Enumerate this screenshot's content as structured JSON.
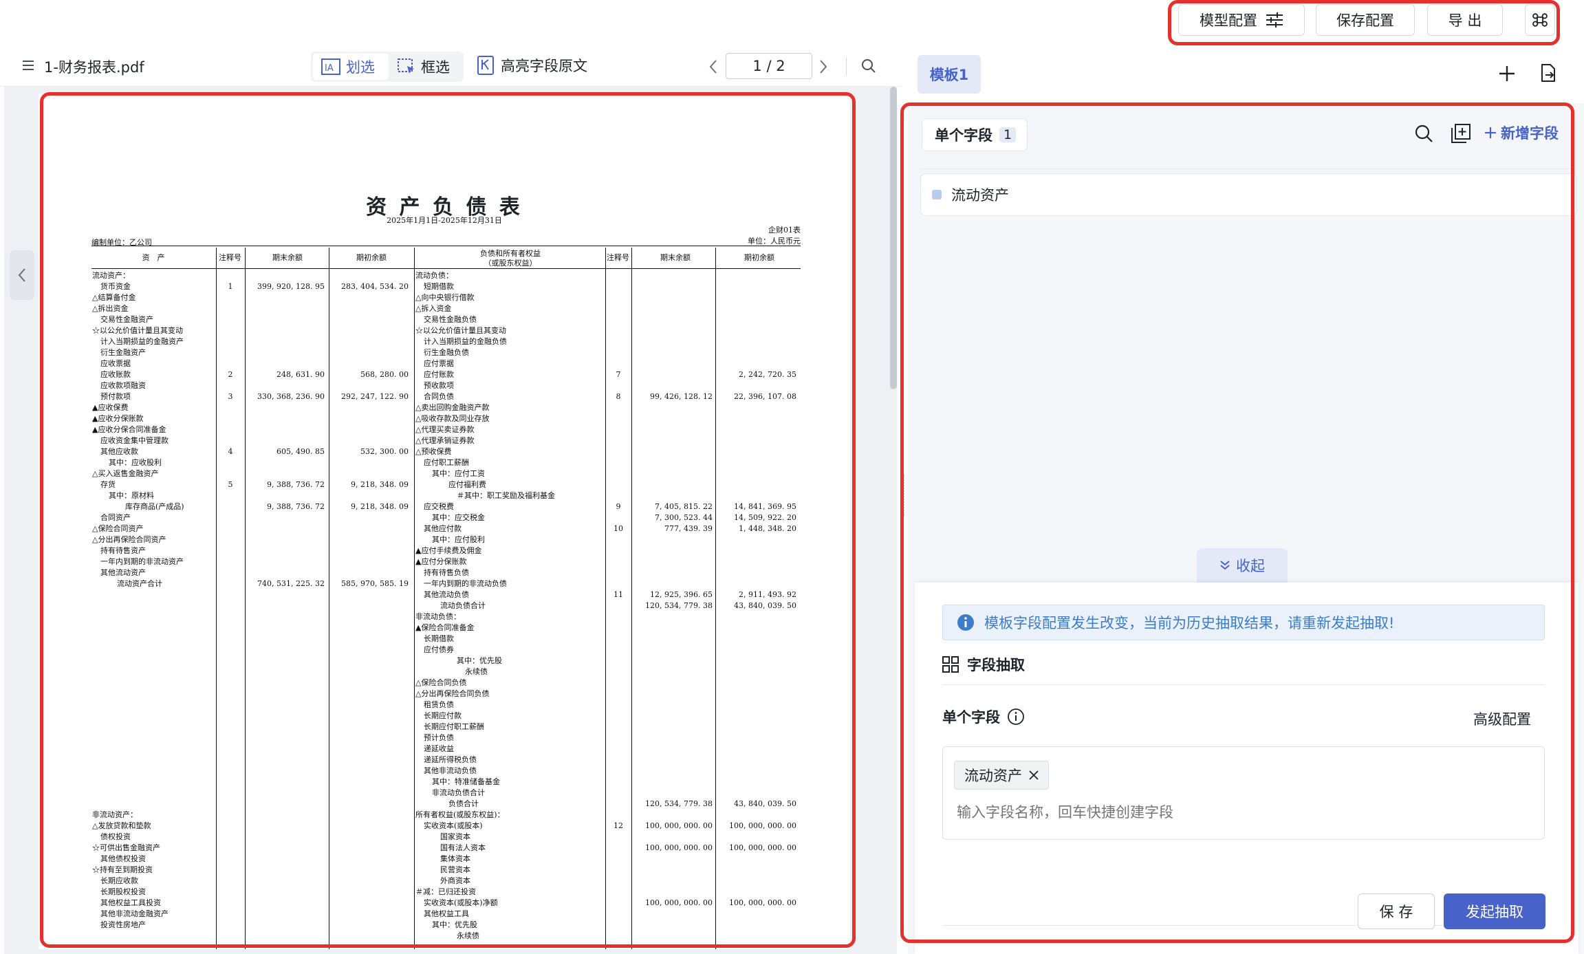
{
  "toolbar": {
    "model_config_label": "模型配置",
    "save_config_label": "保存配置",
    "export_label": "导 出",
    "command_icon": "command-icon"
  },
  "viewer_header": {
    "file_name": "1-财务报表.pdf",
    "mode_line_select": "划选",
    "mode_box_select": "框选",
    "highlight_original": "高亮字段原文",
    "page_indicator": "1 / 2"
  },
  "document": {
    "title": "资 产 负 债 表",
    "period": "2025年1月1日-2025年12月31日",
    "form_no": "企财01表",
    "unit": "单位：人民币元",
    "company": "编制单位：乙公司",
    "headers": {
      "left_item": "资　产",
      "note": "注释号",
      "end_balance": "期末余额",
      "begin_balance": "期初余额",
      "right_item_line1": "负债和所有者权益",
      "right_item_line2": "（或股东权益）"
    },
    "left_rows": [
      {
        "y": 0,
        "label": "流动资产：",
        "indent": 0,
        "note": "",
        "end": "",
        "begin": ""
      },
      {
        "y": 1,
        "label": "货币资金",
        "indent": 1,
        "note": "1",
        "end": "399, 920, 128. 95",
        "begin": "283, 404, 534. 20"
      },
      {
        "y": 2,
        "label": "△结算备付金",
        "indent": 0,
        "note": "",
        "end": "",
        "begin": ""
      },
      {
        "y": 3,
        "label": "△拆出资金",
        "indent": 0,
        "note": "",
        "end": "",
        "begin": ""
      },
      {
        "y": 4,
        "label": "交易性金融资产",
        "indent": 1,
        "note": "",
        "end": "",
        "begin": ""
      },
      {
        "y": 5,
        "label": "☆以公允价值计量且其变动",
        "indent": 0,
        "note": "",
        "end": "",
        "begin": ""
      },
      {
        "y": 6,
        "label": "计入当期损益的金融资产",
        "indent": 1,
        "note": "",
        "end": "",
        "begin": ""
      },
      {
        "y": 7,
        "label": "衍生金融资产",
        "indent": 1,
        "note": "",
        "end": "",
        "begin": ""
      },
      {
        "y": 8,
        "label": "应收票据",
        "indent": 1,
        "note": "",
        "end": "",
        "begin": ""
      },
      {
        "y": 9,
        "label": "应收账款",
        "indent": 1,
        "note": "2",
        "end": "248, 631. 90",
        "begin": "568, 280. 00"
      },
      {
        "y": 10,
        "label": "应收款项融资",
        "indent": 1,
        "note": "",
        "end": "",
        "begin": ""
      },
      {
        "y": 11,
        "label": "预付款项",
        "indent": 1,
        "note": "3",
        "end": "330, 368, 236. 90",
        "begin": "292, 247, 122. 90"
      },
      {
        "y": 12,
        "label": "▲应收保费",
        "indent": 0,
        "note": "",
        "end": "",
        "begin": ""
      },
      {
        "y": 13,
        "label": "▲应收分保账款",
        "indent": 0,
        "note": "",
        "end": "",
        "begin": ""
      },
      {
        "y": 14,
        "label": "▲应收分保合同准备金",
        "indent": 0,
        "note": "",
        "end": "",
        "begin": ""
      },
      {
        "y": 15,
        "label": "应收资金集中管理款",
        "indent": 1,
        "note": "",
        "end": "",
        "begin": ""
      },
      {
        "y": 16,
        "label": "其他应收款",
        "indent": 1,
        "note": "4",
        "end": "605, 490. 85",
        "begin": "532, 300. 00"
      },
      {
        "y": 17,
        "label": "其中：应收股利",
        "indent": 2,
        "note": "",
        "end": "",
        "begin": ""
      },
      {
        "y": 18,
        "label": "△买入返售金融资产",
        "indent": 0,
        "note": "",
        "end": "",
        "begin": ""
      },
      {
        "y": 19,
        "label": "存货",
        "indent": 1,
        "note": "5",
        "end": "9, 388, 736. 72",
        "begin": "9, 218, 348. 09"
      },
      {
        "y": 20,
        "label": "其中：原材料",
        "indent": 2,
        "note": "",
        "end": "",
        "begin": ""
      },
      {
        "y": 21,
        "label": "库存商品(产成品)",
        "indent": 4,
        "note": "",
        "end": "9, 388, 736. 72",
        "begin": "9, 218, 348. 09"
      },
      {
        "y": 22,
        "label": "合同资产",
        "indent": 1,
        "note": "",
        "end": "",
        "begin": ""
      },
      {
        "y": 23,
        "label": "△保险合同资产",
        "indent": 0,
        "note": "",
        "end": "",
        "begin": ""
      },
      {
        "y": 24,
        "label": "△分出再保险合同资产",
        "indent": 0,
        "note": "",
        "end": "",
        "begin": ""
      },
      {
        "y": 25,
        "label": "持有待售资产",
        "indent": 1,
        "note": "",
        "end": "",
        "begin": ""
      },
      {
        "y": 26,
        "label": "一年内到期的非流动资产",
        "indent": 1,
        "note": "",
        "end": "",
        "begin": ""
      },
      {
        "y": 27,
        "label": "其他流动资产",
        "indent": 1,
        "note": "",
        "end": "",
        "begin": ""
      },
      {
        "y": 28,
        "label": "流动资产合计",
        "indent": 3,
        "note": "",
        "end": "740, 531, 225. 32",
        "begin": "585, 970, 585. 19"
      },
      {
        "y": 49,
        "label": "非流动资产：",
        "indent": 0,
        "note": "",
        "end": "",
        "begin": ""
      },
      {
        "y": 50,
        "label": "△发放贷款和垫款",
        "indent": 0,
        "note": "",
        "end": "",
        "begin": ""
      },
      {
        "y": 51,
        "label": "债权投资",
        "indent": 1,
        "note": "",
        "end": "",
        "begin": ""
      },
      {
        "y": 52,
        "label": "☆可供出售金融资产",
        "indent": 0,
        "note": "",
        "end": "",
        "begin": ""
      },
      {
        "y": 53,
        "label": "其他债权投资",
        "indent": 1,
        "note": "",
        "end": "",
        "begin": ""
      },
      {
        "y": 54,
        "label": "☆持有至到期投资",
        "indent": 0,
        "note": "",
        "end": "",
        "begin": ""
      },
      {
        "y": 55,
        "label": "长期应收款",
        "indent": 1,
        "note": "",
        "end": "",
        "begin": ""
      },
      {
        "y": 56,
        "label": "长期股权投资",
        "indent": 1,
        "note": "",
        "end": "",
        "begin": ""
      },
      {
        "y": 57,
        "label": "其他权益工具投资",
        "indent": 1,
        "note": "",
        "end": "",
        "begin": ""
      },
      {
        "y": 58,
        "label": "其他非流动金融资产",
        "indent": 1,
        "note": "",
        "end": "",
        "begin": ""
      },
      {
        "y": 59,
        "label": "投资性房地产",
        "indent": 1,
        "note": "",
        "end": "",
        "begin": ""
      }
    ],
    "right_rows": [
      {
        "y": 0,
        "label": "流动负债：",
        "indent": 0,
        "note": "",
        "end": "",
        "begin": ""
      },
      {
        "y": 1,
        "label": "短期借款",
        "indent": 1,
        "note": "",
        "end": "",
        "begin": ""
      },
      {
        "y": 2,
        "label": "△向中央银行借款",
        "indent": 0,
        "note": "",
        "end": "",
        "begin": ""
      },
      {
        "y": 3,
        "label": "△拆入资金",
        "indent": 0,
        "note": "",
        "end": "",
        "begin": ""
      },
      {
        "y": 4,
        "label": "交易性金融负债",
        "indent": 1,
        "note": "",
        "end": "",
        "begin": ""
      },
      {
        "y": 5,
        "label": "☆以公允价值计量且其变动",
        "indent": 0,
        "note": "",
        "end": "",
        "begin": ""
      },
      {
        "y": 6,
        "label": "计入当期损益的金融负债",
        "indent": 1,
        "note": "",
        "end": "",
        "begin": ""
      },
      {
        "y": 7,
        "label": "衍生金融负债",
        "indent": 1,
        "note": "",
        "end": "",
        "begin": ""
      },
      {
        "y": 8,
        "label": "应付票据",
        "indent": 1,
        "note": "",
        "end": "",
        "begin": ""
      },
      {
        "y": 9,
        "label": "应付账款",
        "indent": 1,
        "note": "7",
        "end": "",
        "begin": "2, 242, 720. 35"
      },
      {
        "y": 10,
        "label": "预收款项",
        "indent": 1,
        "note": "",
        "end": "",
        "begin": ""
      },
      {
        "y": 11,
        "label": "合同负债",
        "indent": 1,
        "note": "8",
        "end": "99, 426, 128. 12",
        "begin": "22, 396, 107. 08"
      },
      {
        "y": 12,
        "label": "△卖出回购金融资产款",
        "indent": 0,
        "note": "",
        "end": "",
        "begin": ""
      },
      {
        "y": 13,
        "label": "△吸收存款及同业存放",
        "indent": 0,
        "note": "",
        "end": "",
        "begin": ""
      },
      {
        "y": 14,
        "label": "△代理买卖证券款",
        "indent": 0,
        "note": "",
        "end": "",
        "begin": ""
      },
      {
        "y": 15,
        "label": "△代理承销证券款",
        "indent": 0,
        "note": "",
        "end": "",
        "begin": ""
      },
      {
        "y": 16,
        "label": "△预收保费",
        "indent": 0,
        "note": "",
        "end": "",
        "begin": ""
      },
      {
        "y": 17,
        "label": "应付职工薪酬",
        "indent": 1,
        "note": "",
        "end": "",
        "begin": ""
      },
      {
        "y": 18,
        "label": "其中：应付工资",
        "indent": 2,
        "note": "",
        "end": "",
        "begin": ""
      },
      {
        "y": 19,
        "label": "应付福利费",
        "indent": 4,
        "note": "",
        "end": "",
        "begin": ""
      },
      {
        "y": 20,
        "label": "＃其中：职工奖励及福利基金",
        "indent": 5,
        "note": "",
        "end": "",
        "begin": ""
      },
      {
        "y": 21,
        "label": "应交税费",
        "indent": 1,
        "note": "9",
        "end": "7, 405, 815. 22",
        "begin": "14, 841, 369. 95"
      },
      {
        "y": 22,
        "label": "其中：应交税金",
        "indent": 2,
        "note": "",
        "end": "7, 300, 523. 44",
        "begin": "14, 509, 922. 20"
      },
      {
        "y": 23,
        "label": "其他应付款",
        "indent": 1,
        "note": "10",
        "end": "777, 439. 39",
        "begin": "1, 448, 348. 20"
      },
      {
        "y": 24,
        "label": "其中：应付股利",
        "indent": 2,
        "note": "",
        "end": "",
        "begin": ""
      },
      {
        "y": 25,
        "label": "▲应付手续费及佣金",
        "indent": 0,
        "note": "",
        "end": "",
        "begin": ""
      },
      {
        "y": 26,
        "label": "▲应付分保账款",
        "indent": 0,
        "note": "",
        "end": "",
        "begin": ""
      },
      {
        "y": 27,
        "label": "持有待售负债",
        "indent": 1,
        "note": "",
        "end": "",
        "begin": ""
      },
      {
        "y": 28,
        "label": "一年内到期的非流动负债",
        "indent": 1,
        "note": "",
        "end": "",
        "begin": ""
      },
      {
        "y": 29,
        "label": "其他流动负债",
        "indent": 1,
        "note": "11",
        "end": "12, 925, 396. 65",
        "begin": "2, 911, 493. 92"
      },
      {
        "y": 30,
        "label": "流动负债合计",
        "indent": 3,
        "note": "",
        "end": "120, 534, 779. 38",
        "begin": "43, 840, 039. 50"
      },
      {
        "y": 31,
        "label": "非流动负债：",
        "indent": 0,
        "note": "",
        "end": "",
        "begin": ""
      },
      {
        "y": 32,
        "label": "▲保险合同准备金",
        "indent": 0,
        "note": "",
        "end": "",
        "begin": ""
      },
      {
        "y": 33,
        "label": "长期借款",
        "indent": 1,
        "note": "",
        "end": "",
        "begin": ""
      },
      {
        "y": 34,
        "label": "应付债券",
        "indent": 1,
        "note": "",
        "end": "",
        "begin": ""
      },
      {
        "y": 35,
        "label": "其中：优先股",
        "indent": 5,
        "note": "",
        "end": "",
        "begin": ""
      },
      {
        "y": 36,
        "label": "永续债",
        "indent": 6,
        "note": "",
        "end": "",
        "begin": ""
      },
      {
        "y": 37,
        "label": "△保险合同负债",
        "indent": 0,
        "note": "",
        "end": "",
        "begin": ""
      },
      {
        "y": 38,
        "label": "△分出再保险合同负债",
        "indent": 0,
        "note": "",
        "end": "",
        "begin": ""
      },
      {
        "y": 39,
        "label": "租赁负债",
        "indent": 1,
        "note": "",
        "end": "",
        "begin": ""
      },
      {
        "y": 40,
        "label": "长期应付款",
        "indent": 1,
        "note": "",
        "end": "",
        "begin": ""
      },
      {
        "y": 41,
        "label": "长期应付职工薪酬",
        "indent": 1,
        "note": "",
        "end": "",
        "begin": ""
      },
      {
        "y": 42,
        "label": "预计负债",
        "indent": 1,
        "note": "",
        "end": "",
        "begin": ""
      },
      {
        "y": 43,
        "label": "递延收益",
        "indent": 1,
        "note": "",
        "end": "",
        "begin": ""
      },
      {
        "y": 44,
        "label": "递延所得税负债",
        "indent": 1,
        "note": "",
        "end": "",
        "begin": ""
      },
      {
        "y": 45,
        "label": "其他非流动负债",
        "indent": 1,
        "note": "",
        "end": "",
        "begin": ""
      },
      {
        "y": 46,
        "label": "其中：特准储备基金",
        "indent": 2,
        "note": "",
        "end": "",
        "begin": ""
      },
      {
        "y": 47,
        "label": "非流动负债合计",
        "indent": 2,
        "note": "",
        "end": "",
        "begin": ""
      },
      {
        "y": 48,
        "label": "负债合计",
        "indent": 4,
        "note": "",
        "end": "120, 534, 779. 38",
        "begin": "43, 840, 039. 50"
      },
      {
        "y": 49,
        "label": "所有者权益(或股东权益)：",
        "indent": 0,
        "note": "",
        "end": "",
        "begin": ""
      },
      {
        "y": 50,
        "label": "实收资本(或股本)",
        "indent": 1,
        "note": "12",
        "end": "100, 000, 000. 00",
        "begin": "100, 000, 000. 00"
      },
      {
        "y": 51,
        "label": "国家资本",
        "indent": 3,
        "note": "",
        "end": "",
        "begin": ""
      },
      {
        "y": 52,
        "label": "国有法人资本",
        "indent": 3,
        "note": "",
        "end": "100, 000, 000. 00",
        "begin": "100, 000, 000. 00"
      },
      {
        "y": 53,
        "label": "集体资本",
        "indent": 3,
        "note": "",
        "end": "",
        "begin": ""
      },
      {
        "y": 54,
        "label": "民营资本",
        "indent": 3,
        "note": "",
        "end": "",
        "begin": ""
      },
      {
        "y": 55,
        "label": "外商资本",
        "indent": 3,
        "note": "",
        "end": "",
        "begin": ""
      },
      {
        "y": 56,
        "label": "＃减：已归还投资",
        "indent": 0,
        "note": "",
        "end": "",
        "begin": ""
      },
      {
        "y": 57,
        "label": "实收资本(或股本)净额",
        "indent": 1,
        "note": "",
        "end": "100, 000, 000. 00",
        "begin": "100, 000, 000. 00"
      },
      {
        "y": 58,
        "label": "其他权益工具",
        "indent": 1,
        "note": "",
        "end": "",
        "begin": ""
      },
      {
        "y": 59,
        "label": "其中：优先股",
        "indent": 2,
        "note": "",
        "end": "",
        "begin": ""
      },
      {
        "y": 60,
        "label": "永续债",
        "indent": 5,
        "note": "",
        "end": "",
        "begin": ""
      }
    ]
  },
  "right_panel": {
    "template_tab": "模板1",
    "single_field_tab": "单个字段",
    "single_field_count": "1",
    "add_field_label": "新增字段",
    "field_item": "流动资产",
    "collapse_label": "收起",
    "alert_text": "模板字段配置发生改变，当前为历史抽取结果，请重新发起抽取!",
    "section_title": "字段抽取",
    "single_field_label": "单个字段",
    "advanced_config": "高级配置",
    "selected_tag": "流动资产",
    "field_input_placeholder": "输入字段名称，回车快捷创建字段",
    "save_label": "保 存",
    "start_extract_label": "发起抽取"
  },
  "colors": {
    "accent": "#4763c9",
    "highlight_frame": "#e5312e",
    "alert_bg": "#eaf1fb",
    "alert_icon": "#3d7cc9"
  }
}
